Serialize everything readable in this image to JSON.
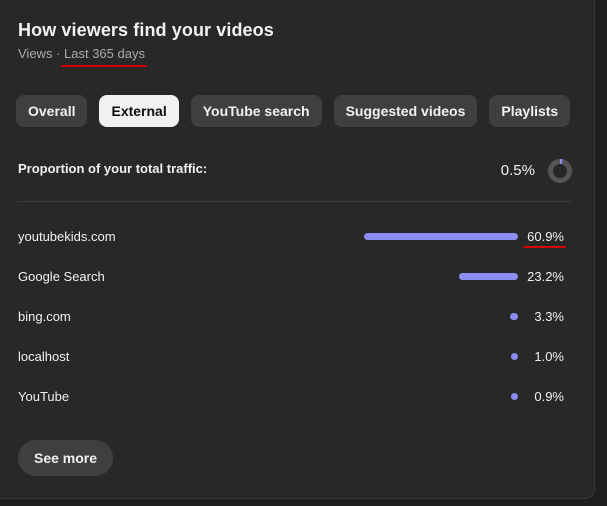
{
  "header": {
    "title": "How viewers find your videos",
    "metric": "Views",
    "separator": " · ",
    "range": "Last 365 days"
  },
  "tabs": [
    {
      "label": "Overall",
      "active": false
    },
    {
      "label": "External",
      "active": true
    },
    {
      "label": "YouTube search",
      "active": false
    },
    {
      "label": "Suggested videos",
      "active": false
    },
    {
      "label": "Playlists",
      "active": false
    }
  ],
  "proportion": {
    "label": "Proportion of your total traffic:",
    "value": "0.5%",
    "fraction": 0.005
  },
  "sources": [
    {
      "name": "youtubekids.com",
      "percent": "60.9%",
      "value": 60.9
    },
    {
      "name": "Google Search",
      "percent": "23.2%",
      "value": 23.2
    },
    {
      "name": "bing.com",
      "percent": "3.3%",
      "value": 3.3
    },
    {
      "name": "localhost",
      "percent": "1.0%",
      "value": 1.0
    },
    {
      "name": "YouTube",
      "percent": "0.9%",
      "value": 0.9
    }
  ],
  "see_more_label": "See more",
  "colors": {
    "bar": "#8b8ef0",
    "annotation": "#d40000"
  }
}
